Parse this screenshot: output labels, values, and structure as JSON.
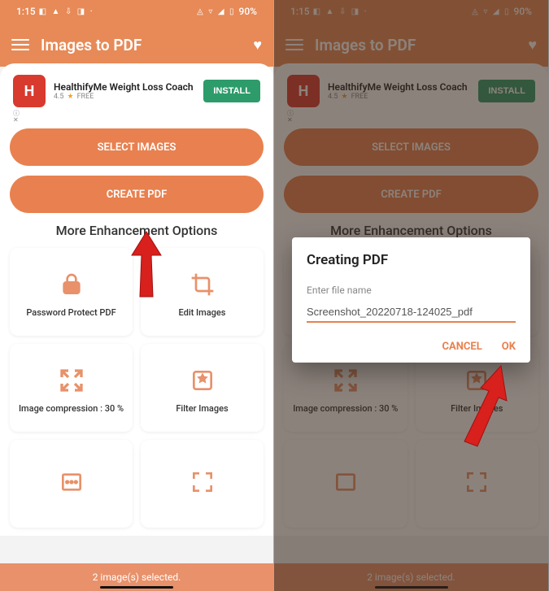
{
  "status": {
    "time": "1:15",
    "battery": "90%",
    "icons_left": "◧ ▲ ⇩ ◨  ·",
    "icons_right": "◬ ▿ ◢ ▯"
  },
  "app": {
    "title": "Images to PDF"
  },
  "ad": {
    "title": "HealthifyMe Weight Loss Coach",
    "rating": "4.5",
    "free": "FREE",
    "install": "INSTALL"
  },
  "buttons": {
    "select": "SELECT IMAGES",
    "create": "CREATE PDF"
  },
  "section": "More Enhancement Options",
  "tiles": [
    {
      "label": "Password Protect PDF"
    },
    {
      "label": "Edit Images"
    },
    {
      "label": "Image compression : 30 %"
    },
    {
      "label": "Filter Images"
    },
    {
      "label": ""
    },
    {
      "label": ""
    }
  ],
  "footer": "2 image(s) selected.",
  "dialog": {
    "title": "Creating PDF",
    "hint": "Enter file name",
    "value": "Screenshot_20220718-124025_pdf",
    "cancel": "CANCEL",
    "ok": "OK"
  }
}
